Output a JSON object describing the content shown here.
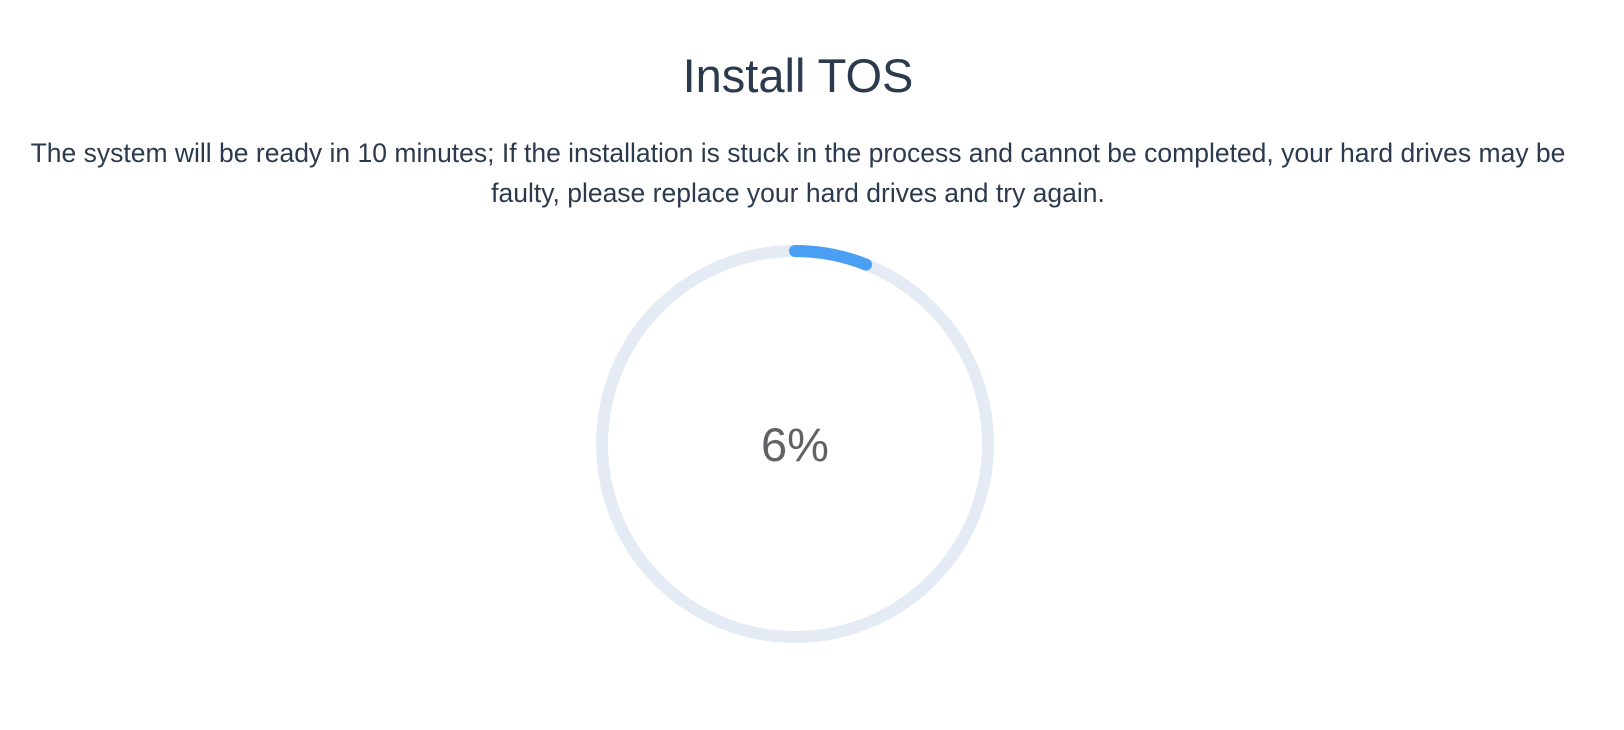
{
  "install": {
    "title": "Install TOS",
    "description": "The system will be ready in 10 minutes; If the installation is stuck in the process and cannot be completed, your hard drives may be faulty, please replace your hard drives and try again."
  },
  "progress": {
    "percent": 6,
    "label": "6%",
    "track_color": "#e5ebf5",
    "fill_color": "#4a9ff5"
  }
}
